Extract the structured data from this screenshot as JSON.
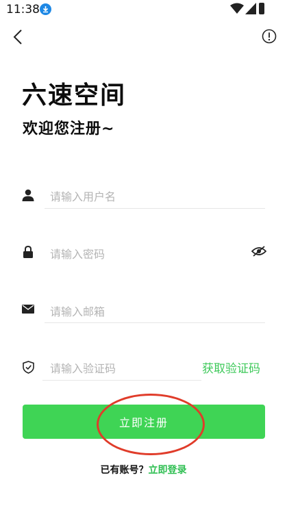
{
  "status_bar": {
    "time": "11:38"
  },
  "header": {
    "back_icon": "chevron-left-icon",
    "info_icon": "info-circle-icon"
  },
  "title": "六速空间",
  "subtitle": "欢迎您注册~",
  "fields": {
    "username": {
      "placeholder": "请输入用户名",
      "icon": "person-icon"
    },
    "password": {
      "placeholder": "请输入密码",
      "icon": "lock-icon",
      "toggle_icon": "eye-off-icon"
    },
    "email": {
      "placeholder": "请输入邮箱",
      "icon": "mail-icon"
    },
    "code": {
      "placeholder": "请输入验证码",
      "icon": "shield-check-icon",
      "button": "获取验证码"
    }
  },
  "submit_label": "立即注册",
  "login_prompt": {
    "question": "已有账号？",
    "link": "立即登录"
  },
  "colors": {
    "accent": "#3fd455",
    "link": "#2fbf52",
    "annotation": "#e03c2a"
  }
}
